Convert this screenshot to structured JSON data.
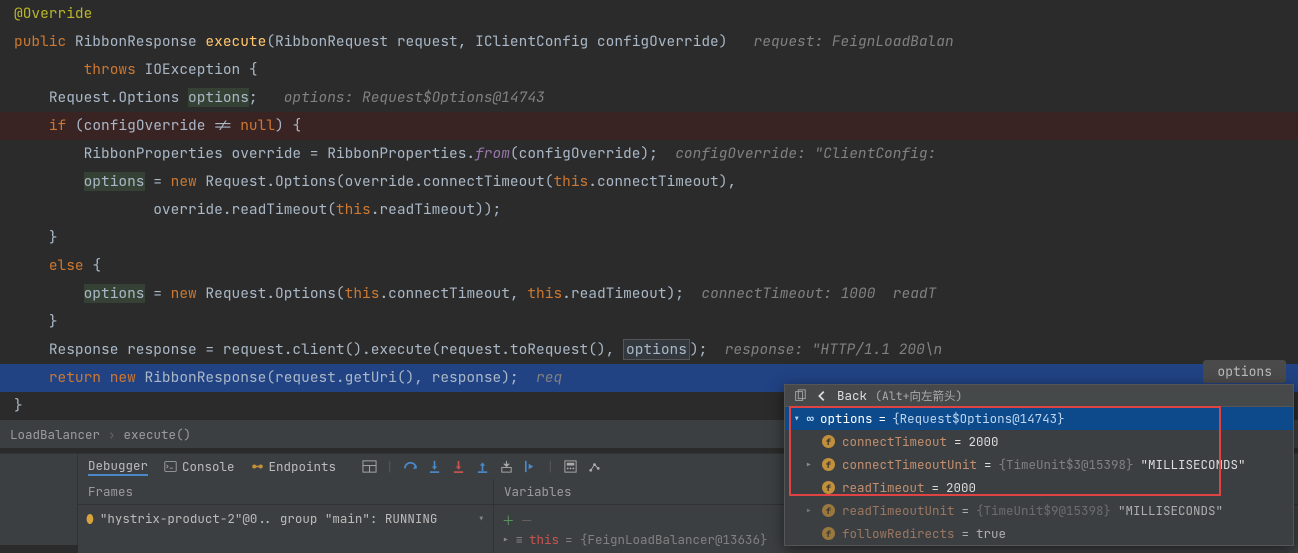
{
  "code": {
    "ann_override": "@Override",
    "kw_public": "public",
    "type_ribbonresponse": "RibbonResponse",
    "method_execute": "execute",
    "sig_open": "(RibbonRequest request, IClientConfig configOverride)",
    "inline_request": "request: FeignLoadBalan",
    "kw_throws": "throws",
    "type_ioexception": "IOException",
    "brace_open": "{",
    "line3_a": "Request.Options",
    "line3_var": "options",
    "line3_semi": ";",
    "line3_hint": "options: Request$Options@14743",
    "kw_if": "if",
    "cond": "(configOverride != ",
    "kw_null": "null",
    "cond_close": ") {",
    "line5_a": "RibbonProperties override = RibbonProperties.",
    "line5_from": "from",
    "line5_b": "(configOverride);",
    "line5_hint": "configOverride: \"ClientConfig:",
    "line6_var": "options",
    "line6_eq": " = ",
    "kw_new": "new",
    "line6_b": " Request.Options(override.connectTimeout(",
    "kw_this": "this",
    "line6_c": ".connectTimeout),",
    "line7_a": "override.readTimeout(",
    "line7_b": ".readTimeout));",
    "brace_close": "}",
    "kw_else": "else",
    "line10_var": "options",
    "line10_b": " Request.Options(",
    "line10_c": ".connectTimeout, ",
    "line10_d": ".readTimeout);",
    "line10_hint": "connectTimeout: 1000  readT",
    "line12_a": "Response response = request.client().execute(request.toRequest(), ",
    "line12_var": "options",
    "line12_b": ");",
    "line12_hint": "response: \"HTTP/1.1 200\\n",
    "kw_return": "return",
    "line13_b": " RibbonResponse(request.getUri(), response);",
    "line13_hint": "req"
  },
  "right_float": "options",
  "breadcrumb": {
    "a": "LoadBalancer",
    "b": "execute()"
  },
  "debug": {
    "tab_debugger": "Debugger",
    "tab_console": "Console",
    "tab_endpoints": "Endpoints",
    "frames_header": "Frames",
    "vars_header": "Variables",
    "frame_row": "\"hystrix-product-2\"@0.. group \"main\": RUNNING",
    "var_row_this": "this",
    "var_row_this_val": " = {FeignLoadBalancer@13636}"
  },
  "popup": {
    "back": "Back",
    "back_kbd": "(Alt+向左箭头)",
    "head_name": "options",
    "head_val": "{Request$Options@14743}",
    "rows": [
      {
        "arrow": false,
        "name": "connectTimeout",
        "val": "2000",
        "dim": false
      },
      {
        "arrow": true,
        "name": "connectTimeoutUnit",
        "dimval": "{TimeUnit$3@15398}",
        "val": "\"MILLISECONDS\"",
        "dim": false
      },
      {
        "arrow": false,
        "name": "readTimeout",
        "val": "2000",
        "dim": false
      },
      {
        "arrow": true,
        "name": "readTimeoutUnit",
        "dimval": "{TimeUnit$9@15398}",
        "val": "\"MILLISECONDS\"",
        "dim": true
      },
      {
        "arrow": false,
        "name": "followRedirects",
        "val": "true",
        "dim": true
      }
    ]
  }
}
